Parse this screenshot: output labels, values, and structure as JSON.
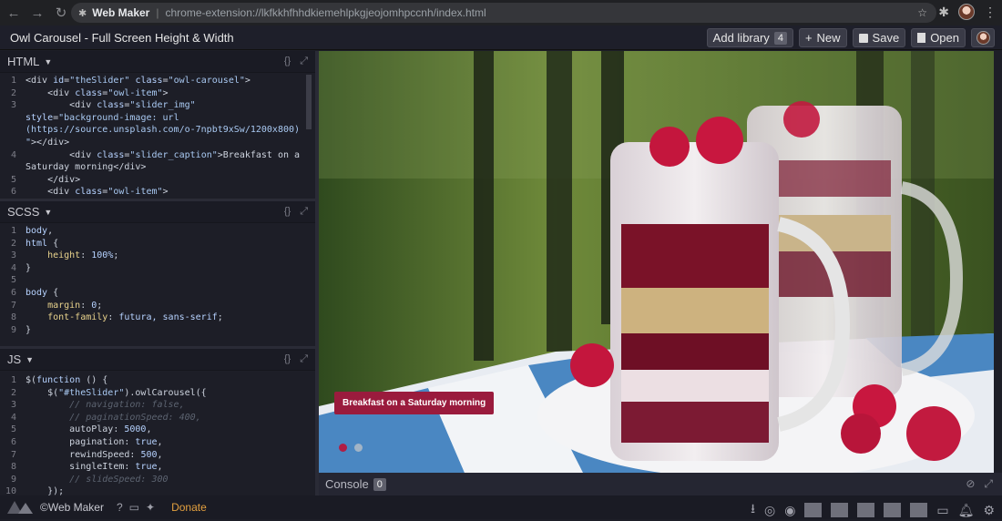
{
  "browser": {
    "site_name": "Web Maker",
    "url": "chrome-extension://lkfkkhfhhdkiemehlpkgjeojomhpccnh/index.html"
  },
  "app": {
    "title": "Owl Carousel - Full Screen Height & Width",
    "buttons": {
      "add_library": "Add library",
      "library_count": "4",
      "new": "New",
      "save": "Save",
      "open": "Open"
    }
  },
  "panes": {
    "html": {
      "title": "HTML",
      "lines": [
        {
          "n": "1",
          "segs": [
            [
              "t-tag",
              "<div "
            ],
            [
              "t-attr",
              "id"
            ],
            [
              "t-tag",
              "="
            ],
            [
              "t-str",
              "\"theSlider\""
            ],
            [
              "t-tag",
              " "
            ],
            [
              "t-attr",
              "class"
            ],
            [
              "t-tag",
              "="
            ],
            [
              "t-str",
              "\"owl-carousel\""
            ],
            [
              "t-tag",
              ">"
            ]
          ]
        },
        {
          "n": "2",
          "segs": [
            [
              "t-tag",
              "    <div "
            ],
            [
              "t-attr",
              "class"
            ],
            [
              "t-tag",
              "="
            ],
            [
              "t-str",
              "\"owl-item\""
            ],
            [
              "t-tag",
              ">"
            ]
          ]
        },
        {
          "n": "3",
          "segs": [
            [
              "t-tag",
              "        <div "
            ],
            [
              "t-attr",
              "class"
            ],
            [
              "t-tag",
              "="
            ],
            [
              "t-str",
              "\"slider_img\""
            ]
          ]
        },
        {
          "n": "",
          "segs": [
            [
              "t-attr",
              "style"
            ],
            [
              "t-tag",
              "="
            ],
            [
              "t-str",
              "\"background-image: url"
            ]
          ]
        },
        {
          "n": "",
          "segs": [
            [
              "t-str",
              "(https://source.unsplash.com/o-7npbt9xSw/1200x800)"
            ]
          ]
        },
        {
          "n": "",
          "segs": [
            [
              "t-str",
              "\""
            ],
            [
              "t-tag",
              "></div>"
            ]
          ]
        },
        {
          "n": "4",
          "segs": [
            [
              "t-tag",
              "        <div "
            ],
            [
              "t-attr",
              "class"
            ],
            [
              "t-tag",
              "="
            ],
            [
              "t-str",
              "\"slider_caption\""
            ],
            [
              "t-tag",
              ">Breakfast on a"
            ]
          ]
        },
        {
          "n": "",
          "segs": [
            [
              "t-tag",
              "Saturday morning</div>"
            ]
          ]
        },
        {
          "n": "5",
          "segs": [
            [
              "t-tag",
              "    </div>"
            ]
          ]
        },
        {
          "n": "6",
          "segs": [
            [
              "t-tag",
              "    <div "
            ],
            [
              "t-attr",
              "class"
            ],
            [
              "t-tag",
              "="
            ],
            [
              "t-str",
              "\"owl-item\""
            ],
            [
              "t-tag",
              ">"
            ]
          ]
        }
      ]
    },
    "scss": {
      "title": "SCSS",
      "lines": [
        {
          "n": "1",
          "segs": [
            [
              "t-sel",
              "body"
            ],
            [
              "t-tag",
              ","
            ]
          ]
        },
        {
          "n": "2",
          "segs": [
            [
              "t-sel",
              "html"
            ],
            [
              "t-tag",
              " {"
            ]
          ]
        },
        {
          "n": "3",
          "segs": [
            [
              "t-prop",
              "    height"
            ],
            [
              "t-tag",
              ": "
            ],
            [
              "t-val",
              "100%"
            ],
            [
              "t-tag",
              ";"
            ]
          ]
        },
        {
          "n": "4",
          "segs": [
            [
              "t-tag",
              "}"
            ]
          ]
        },
        {
          "n": "5",
          "segs": [
            [
              "t-tag",
              ""
            ]
          ]
        },
        {
          "n": "6",
          "segs": [
            [
              "t-sel",
              "body"
            ],
            [
              "t-tag",
              " {"
            ]
          ]
        },
        {
          "n": "7",
          "segs": [
            [
              "t-prop",
              "    margin"
            ],
            [
              "t-tag",
              ": "
            ],
            [
              "t-val",
              "0"
            ],
            [
              "t-tag",
              ";"
            ]
          ]
        },
        {
          "n": "8",
          "segs": [
            [
              "t-prop",
              "    font-family"
            ],
            [
              "t-tag",
              ": "
            ],
            [
              "t-val",
              "futura, sans-serif"
            ],
            [
              "t-tag",
              ";"
            ]
          ]
        },
        {
          "n": "9",
          "segs": [
            [
              "t-tag",
              "}"
            ]
          ]
        }
      ]
    },
    "js": {
      "title": "JS",
      "lines": [
        {
          "n": "1",
          "segs": [
            [
              "t-tag",
              "$("
            ],
            [
              "t-kw",
              "function"
            ],
            [
              "t-tag",
              " () {"
            ]
          ]
        },
        {
          "n": "2",
          "segs": [
            [
              "t-tag",
              "    $("
            ],
            [
              "t-str",
              "\"#theSlider\""
            ],
            [
              "t-tag",
              ").owlCarousel({"
            ]
          ]
        },
        {
          "n": "3",
          "segs": [
            [
              "t-com",
              "        // navigation: false,"
            ]
          ]
        },
        {
          "n": "4",
          "segs": [
            [
              "t-com",
              "        // paginationSpeed: 400,"
            ]
          ]
        },
        {
          "n": "5",
          "segs": [
            [
              "t-tag",
              "        autoPlay: "
            ],
            [
              "t-val",
              "5000"
            ],
            [
              "t-tag",
              ","
            ]
          ]
        },
        {
          "n": "6",
          "segs": [
            [
              "t-tag",
              "        pagination: "
            ],
            [
              "t-kw",
              "true"
            ],
            [
              "t-tag",
              ","
            ]
          ]
        },
        {
          "n": "7",
          "segs": [
            [
              "t-tag",
              "        rewindSpeed: "
            ],
            [
              "t-val",
              "500"
            ],
            [
              "t-tag",
              ","
            ]
          ]
        },
        {
          "n": "8",
          "segs": [
            [
              "t-tag",
              "        singleItem: "
            ],
            [
              "t-kw",
              "true"
            ],
            [
              "t-tag",
              ","
            ]
          ]
        },
        {
          "n": "9",
          "segs": [
            [
              "t-com",
              "        // slideSpeed: 300"
            ]
          ]
        },
        {
          "n": "10",
          "segs": [
            [
              "t-tag",
              "    });"
            ]
          ]
        }
      ]
    }
  },
  "preview": {
    "caption": "Breakfast on a Saturday morning"
  },
  "console": {
    "label": "Console",
    "count": "0"
  },
  "footer": {
    "brand": "©Web Maker",
    "donate": "Donate"
  }
}
